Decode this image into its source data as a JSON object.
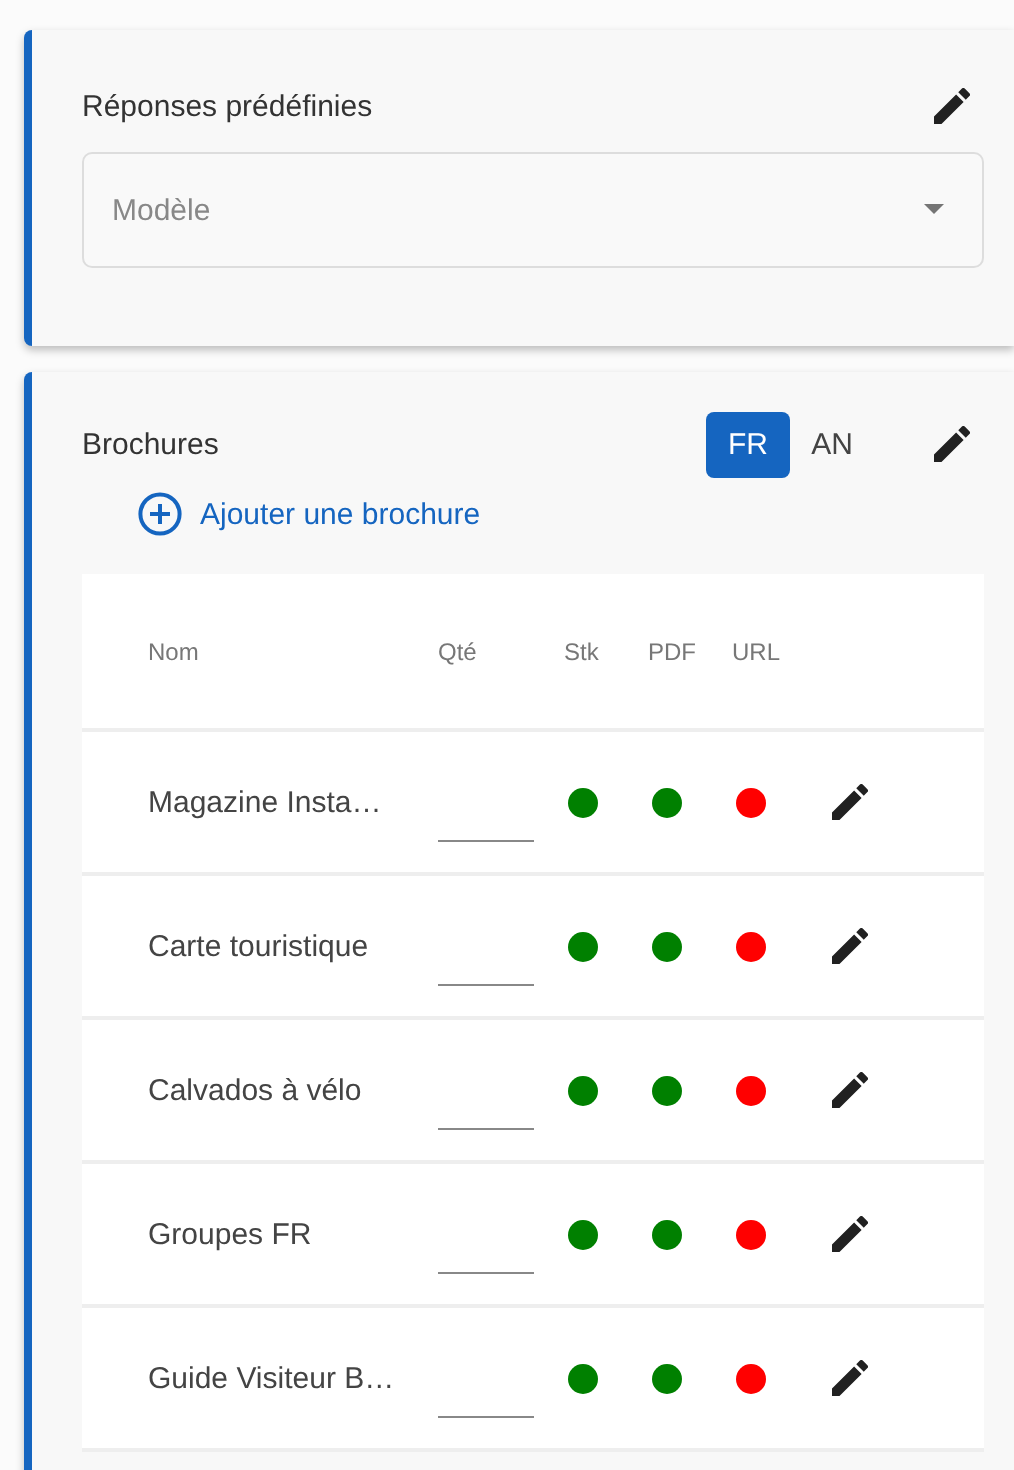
{
  "canned_responses": {
    "title": "Réponses prédéfinies",
    "select": {
      "placeholder": "Modèle"
    }
  },
  "brochures": {
    "title": "Brochures",
    "languages": [
      {
        "label": "FR",
        "selected": true
      },
      {
        "label": "AN",
        "selected": false
      }
    ],
    "add_link": "Ajouter une brochure",
    "table": {
      "columns": [
        "Nom",
        "Qté",
        "Stk",
        "PDF",
        "URL"
      ],
      "rows": [
        {
          "name": "Magazine Insta…",
          "status": [
            {
              "color": "#008000"
            },
            {
              "color": "#008000"
            },
            {
              "color": "#ff0000"
            }
          ]
        },
        {
          "name": "Carte touristique",
          "status": [
            {
              "color": "#008000"
            },
            {
              "color": "#008000"
            },
            {
              "color": "#ff0000"
            }
          ]
        },
        {
          "name": "Calvados à vélo",
          "status": [
            {
              "color": "#008000"
            },
            {
              "color": "#008000"
            },
            {
              "color": "#ff0000"
            }
          ]
        },
        {
          "name": "Groupes FR",
          "status": [
            {
              "color": "#008000"
            },
            {
              "color": "#008000"
            },
            {
              "color": "#ff0000"
            }
          ]
        },
        {
          "name": "Guide Visiteur B…",
          "status": [
            {
              "color": "#008000"
            },
            {
              "color": "#008000"
            },
            {
              "color": "#ff0000"
            }
          ]
        }
      ]
    }
  }
}
